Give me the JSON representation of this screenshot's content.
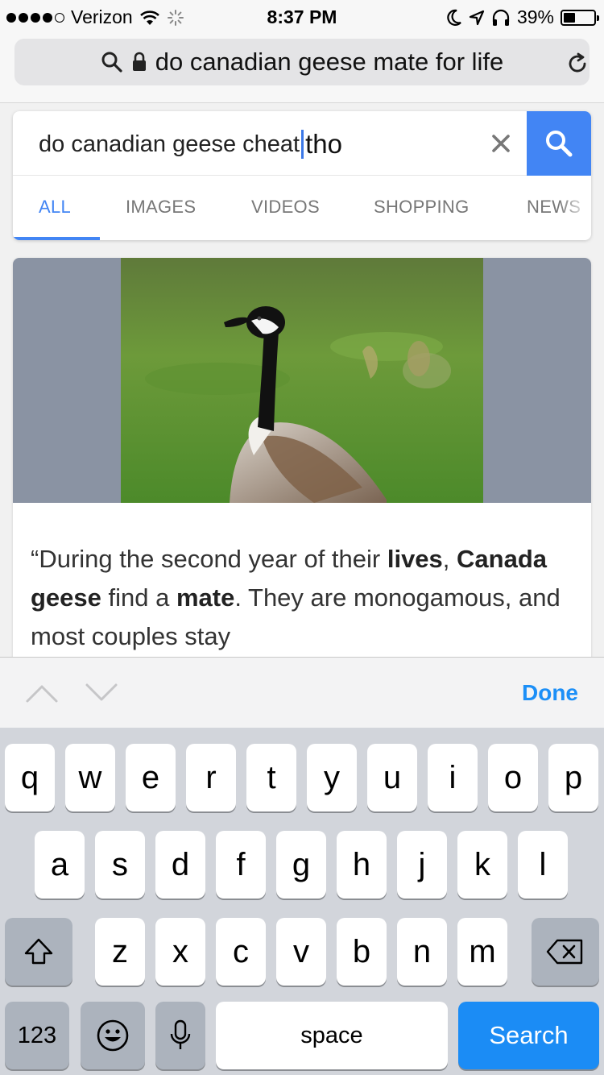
{
  "status_bar": {
    "carrier": "Verizon",
    "time": "8:37 PM",
    "battery_percent": "39%",
    "battery_level": 0.39
  },
  "browser": {
    "url_text": "do canadian geese mate for life"
  },
  "search": {
    "query_typed": "do canadian geese cheat",
    "query_suggestion": "tho",
    "tabs": [
      {
        "label": "ALL",
        "active": true
      },
      {
        "label": "IMAGES",
        "active": false
      },
      {
        "label": "VIDEOS",
        "active": false
      },
      {
        "label": "SHOPPING",
        "active": false
      },
      {
        "label": "NEWS",
        "active": false
      }
    ]
  },
  "result": {
    "snippet_parts": [
      {
        "text": "“During the second year of their ",
        "bold": false
      },
      {
        "text": "lives",
        "bold": true
      },
      {
        "text": ", ",
        "bold": false
      },
      {
        "text": "Canada geese",
        "bold": true
      },
      {
        "text": " find a ",
        "bold": false
      },
      {
        "text": "mate",
        "bold": true
      },
      {
        "text": ". They are monogamous, and most couples stay",
        "bold": false
      }
    ]
  },
  "accessory": {
    "done_label": "Done"
  },
  "keyboard": {
    "row1": [
      "q",
      "w",
      "e",
      "r",
      "t",
      "y",
      "u",
      "i",
      "o",
      "p"
    ],
    "row2": [
      "a",
      "s",
      "d",
      "f",
      "g",
      "h",
      "j",
      "k",
      "l"
    ],
    "row3": [
      "z",
      "x",
      "c",
      "v",
      "b",
      "n",
      "m"
    ],
    "numbers_label": "123",
    "space_label": "space",
    "search_label": "Search"
  },
  "colors": {
    "google_blue": "#4285f4",
    "ios_blue": "#1b8cf5",
    "keyboard_bg": "#d2d5db"
  }
}
